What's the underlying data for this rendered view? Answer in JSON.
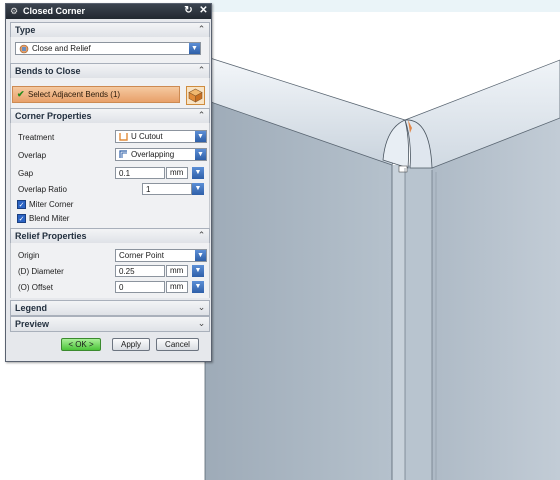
{
  "dialog": {
    "title": "Closed Corner",
    "title_icon": "gear-icon",
    "reset_icon": "reset-icon",
    "close_icon": "close-icon",
    "type_section": {
      "label": "Type",
      "value": "Close and Relief"
    },
    "bends_section": {
      "label": "Bends to Close",
      "select_label": "Select Adjacent Bends (1)"
    },
    "corner_section": {
      "label": "Corner Properties",
      "treatment_label": "Treatment",
      "treatment_value": "U Cutout",
      "overlap_label": "Overlap",
      "overlap_value": "Overlapping",
      "gap_label": "Gap",
      "gap_value": "0.1",
      "gap_unit": "mm",
      "overlap_ratio_label": "Overlap Ratio",
      "overlap_ratio_value": "1",
      "miter_corner_label": "Miter Corner",
      "miter_corner_checked": true,
      "blend_miter_label": "Blend Miter",
      "blend_miter_checked": true
    },
    "relief_section": {
      "label": "Relief Properties",
      "origin_label": "Origin",
      "origin_value": "Corner Point",
      "diameter_label": "(D) Diameter",
      "diameter_value": "0.25",
      "diameter_unit": "mm",
      "offset_label": "(O) Offset",
      "offset_value": "0",
      "offset_unit": "mm"
    },
    "legend_label": "Legend",
    "preview_label": "Preview",
    "buttons": {
      "ok": "< OK >",
      "apply": "Apply",
      "cancel": "Cancel"
    }
  },
  "colors": {
    "accent": "#2e5fa8",
    "highlight": "#e8a06a",
    "ok_green": "#4cc43a",
    "model_face": "#a6b3bf"
  }
}
